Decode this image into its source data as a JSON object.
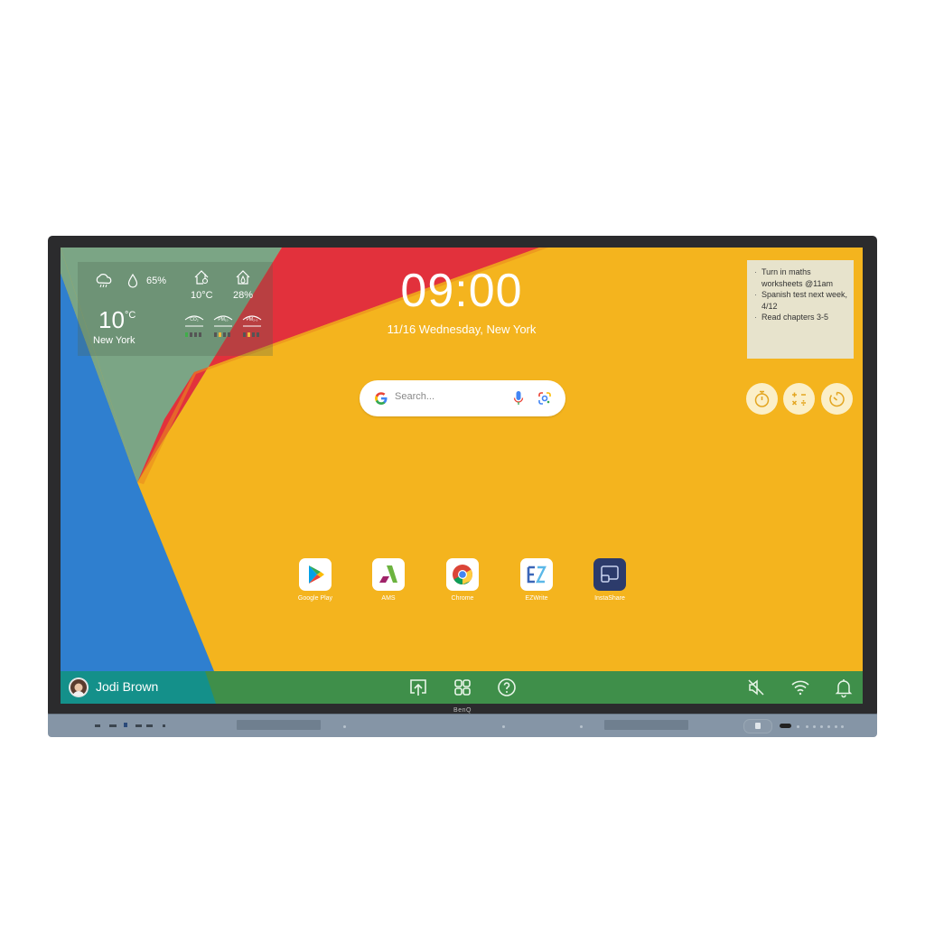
{
  "weather": {
    "condition_icon": "cloud-rain-icon",
    "humidity_icon": "water-drop-icon",
    "humidity": "65%",
    "indoor_temp_icon": "home-thermometer-icon",
    "indoor_temp": "10°C",
    "indoor_humidity_icon": "home-humidity-icon",
    "indoor_humidity": "28%",
    "temperature": "10",
    "temperature_unit": "°C",
    "city": "New York",
    "air_quality": [
      {
        "label": "CO₂",
        "icon": "co2-sensor-icon",
        "level_color": "#3fae49"
      },
      {
        "label": "PM₁₀",
        "icon": "pm10-sensor-icon",
        "level_color": "#f2b93b"
      },
      {
        "label": "PM₂.₅",
        "icon": "pm25-sensor-icon",
        "level_color": "#f2b93b"
      }
    ]
  },
  "clock": {
    "time": "09:00",
    "date": "11/16 Wednesday, New York"
  },
  "search": {
    "placeholder": "Search...",
    "logo_icon": "google-g-icon",
    "voice_icon": "microphone-icon",
    "lens_icon": "google-lens-icon"
  },
  "note": {
    "items": [
      "Turn in maths worksheets @11am",
      "Spanish test next week, 4/12",
      "Read chapters 3-5"
    ]
  },
  "tools": [
    {
      "name": "stopwatch",
      "icon": "stopwatch-icon"
    },
    {
      "name": "calculator",
      "icon": "calculator-icon"
    },
    {
      "name": "timer",
      "icon": "timer-icon"
    }
  ],
  "apps": [
    {
      "label": "Google Play",
      "icon": "google-play-icon"
    },
    {
      "label": "AMS",
      "icon": "ams-icon"
    },
    {
      "label": "Chrome",
      "icon": "chrome-icon"
    },
    {
      "label": "EZWrite",
      "icon": "ezwrite-icon"
    },
    {
      "label": "InstaShare",
      "icon": "instashare-icon"
    }
  ],
  "taskbar": {
    "user_name": "Jodi Brown",
    "center_icons": [
      "share-screen-icon",
      "apps-grid-icon",
      "help-icon"
    ],
    "right_icons": [
      "speaker-muted-icon",
      "wifi-icon",
      "bell-icon"
    ]
  },
  "device": {
    "brand": "BenQ"
  },
  "colors": {
    "wallpaper_yellow": "#f4b41e",
    "wallpaper_red": "#e2313c",
    "wallpaper_blue": "#2f7fcf",
    "wallpaper_sage": "#7ba585",
    "taskbar_green": "#3f8f4a",
    "taskbar_teal": "#14908a"
  }
}
